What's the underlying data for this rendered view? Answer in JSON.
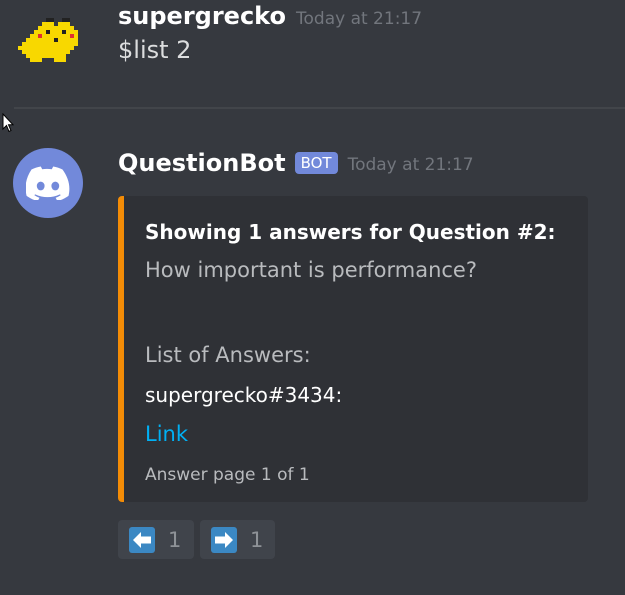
{
  "message1": {
    "username": "supergrecko",
    "timestamp": "Today at 21:17",
    "text": "$list 2"
  },
  "message2": {
    "username": "QuestionBot",
    "badge": "BOT",
    "timestamp": "Today at 21:17",
    "embed": {
      "accent_color": "#f48c06",
      "title": "Showing 1 answers for Question #2:",
      "description": "How important is performance?",
      "list_label": "List of Answers:",
      "field_name": "supergrecko#3434:",
      "link_text": "Link",
      "footer": "Answer page 1 of 1"
    },
    "reactions": [
      {
        "icon": "arrow-left-icon",
        "count": "1"
      },
      {
        "icon": "arrow-right-icon",
        "count": "1"
      }
    ]
  },
  "colors": {
    "background": "#36393f",
    "embed_background": "#2f3136",
    "blurple": "#7289da",
    "link": "#00b0f4"
  }
}
